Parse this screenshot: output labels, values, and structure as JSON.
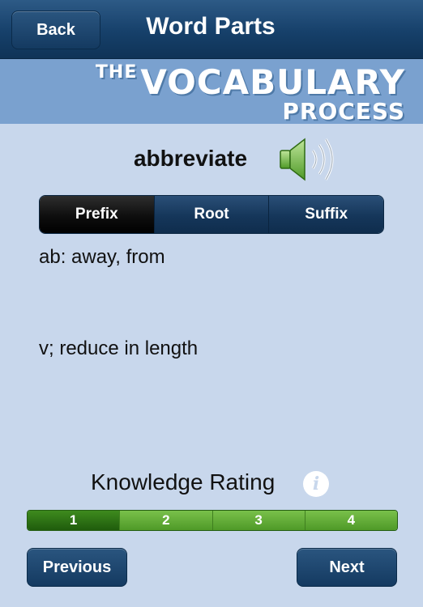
{
  "navbar": {
    "back_label": "Back",
    "title": "Word Parts"
  },
  "banner": {
    "line1_prefix": "THE",
    "line1_main": "VOCABULARY",
    "line2": "PROCESS"
  },
  "word": {
    "text": "abbreviate",
    "speaker_icon": "speaker-icon"
  },
  "segments": {
    "items": [
      "Prefix",
      "Root",
      "Suffix"
    ],
    "selected": "Prefix"
  },
  "content": {
    "part_meaning": "ab: away, from",
    "definition": "v; reduce in length"
  },
  "rating": {
    "label": "Knowledge Rating",
    "info_icon": "info-icon",
    "options": [
      "1",
      "2",
      "3",
      "4"
    ],
    "selected": "1"
  },
  "footer": {
    "previous_label": "Previous",
    "next_label": "Next"
  },
  "colors": {
    "navbar": "#16406a",
    "background": "#c8d7ec",
    "banner": "#7aa1cf",
    "rating_green": "#4f9a28",
    "rating_selected": "#1f5c0c"
  }
}
